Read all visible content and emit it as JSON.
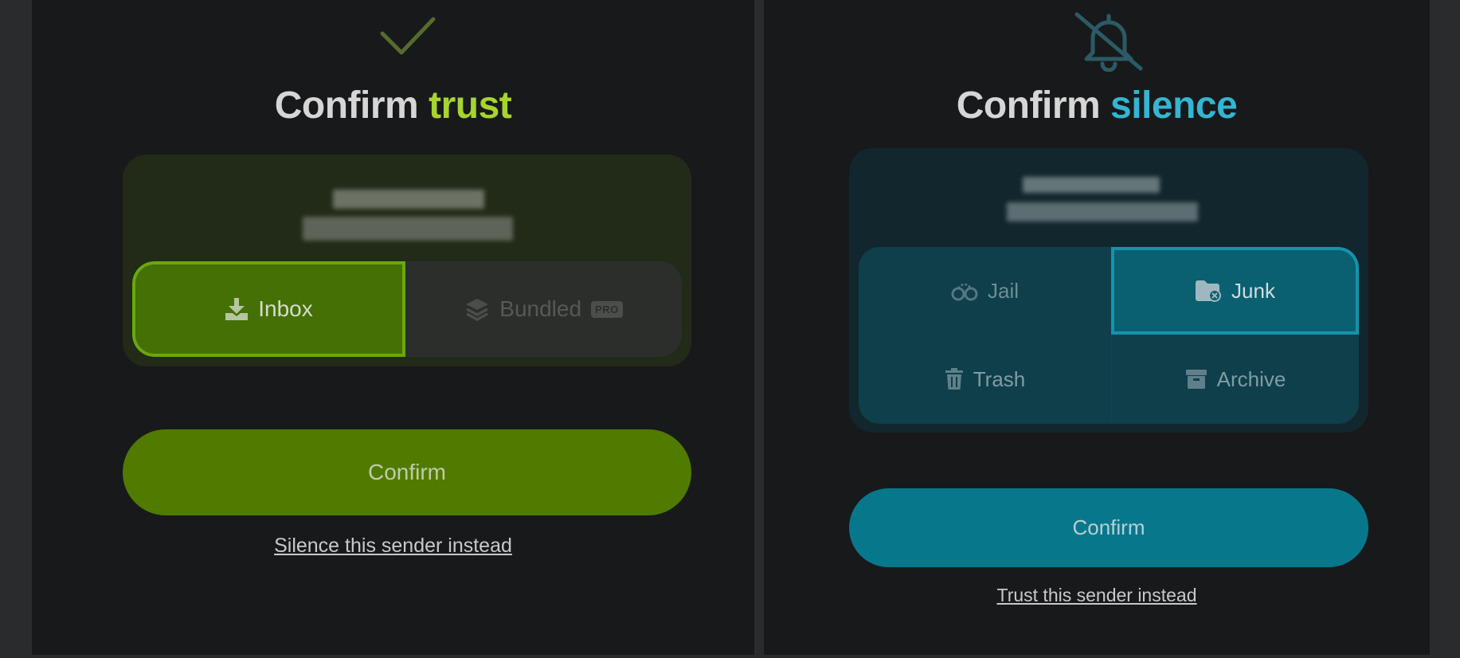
{
  "left_panel": {
    "icon": "checkmark-icon",
    "title_prefix": "Confirm",
    "title_accent": "trust",
    "accent_color": "#a6d430",
    "options": {
      "inbox": {
        "label": "Inbox",
        "icon": "download-tray-icon",
        "selected": true
      },
      "bundled": {
        "label": "Bundled",
        "icon": "layers-icon",
        "badge": "PRO",
        "selected": false
      }
    },
    "confirm_label": "Confirm",
    "confirm_color": "#517a00",
    "alt_link": "Silence this sender instead"
  },
  "right_panel": {
    "icon": "bell-slash-icon",
    "title_prefix": "Confirm",
    "title_accent": "silence",
    "accent_color": "#33b6d1",
    "options": {
      "jail": {
        "label": "Jail",
        "icon": "handcuffs-icon",
        "selected": false
      },
      "junk": {
        "label": "Junk",
        "icon": "folder-x-icon",
        "selected": true
      },
      "trash": {
        "label": "Trash",
        "icon": "trash-icon",
        "selected": false
      },
      "archive": {
        "label": "Archive",
        "icon": "archive-box-icon",
        "selected": false
      }
    },
    "confirm_label": "Confirm",
    "confirm_color": "#07788c",
    "alt_link": "Trust this sender instead"
  }
}
